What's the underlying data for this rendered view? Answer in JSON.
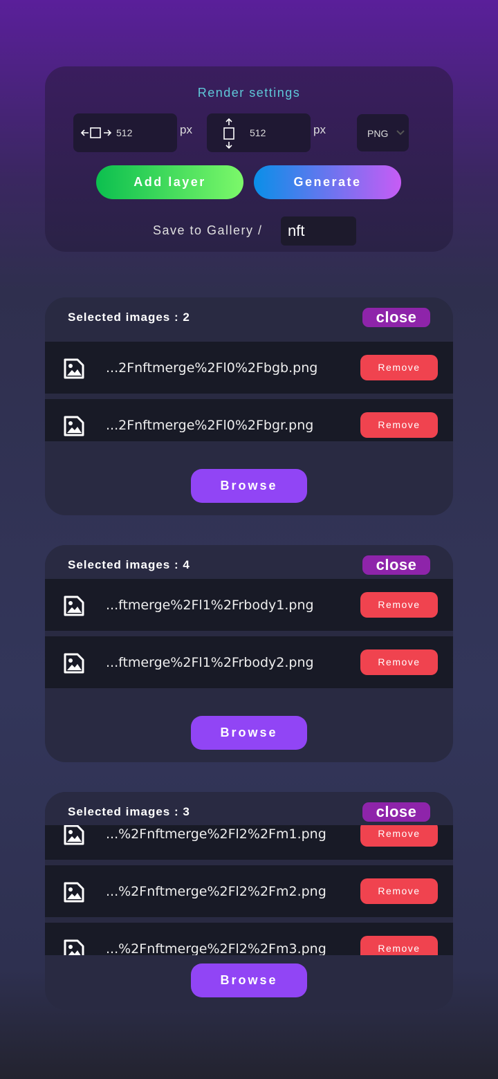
{
  "render": {
    "title": "Render settings",
    "width": "512",
    "height": "512",
    "unit": "px",
    "format": "PNG",
    "add_layer": "Add layer",
    "generate": "Generate",
    "save_label": "Save to Gallery /",
    "gallery": "nft"
  },
  "colors": {
    "add_layer": [
      "#0cbf4f",
      "#7cf86a"
    ],
    "generate": [
      "#0a8fe8",
      "#c75cf5"
    ],
    "remove": "#f0434f",
    "browse": "#9145f5",
    "close": "#8e24aa",
    "title": "#5fc8d8"
  },
  "layers": [
    {
      "count_label": "Selected images : 2",
      "close": "close",
      "browse": "Browse",
      "items": [
        {
          "name": "...2Fnftmerge%2Fl0%2Fbgb.png",
          "remove": "Remove"
        },
        {
          "name": "...2Fnftmerge%2Fl0%2Fbgr.png",
          "remove": "Remove"
        }
      ]
    },
    {
      "count_label": "Selected images : 4",
      "close": "close",
      "browse": "Browse",
      "items": [
        {
          "name": "",
          "remove": ""
        },
        {
          "name": "...ftmerge%2Fl1%2Frbody1.png",
          "remove": "Remove"
        },
        {
          "name": "...ftmerge%2Fl1%2Frbody2.png",
          "remove": "Remove"
        }
      ]
    },
    {
      "count_label": "Selected images : 3",
      "close": "close",
      "browse": "Browse",
      "items": [
        {
          "name": "...%2Fnftmerge%2Fl2%2Fm1.png",
          "remove": "Remove"
        },
        {
          "name": "...%2Fnftmerge%2Fl2%2Fm2.png",
          "remove": "Remove"
        },
        {
          "name": "...%2Fnftmerge%2Fl2%2Fm3.png",
          "remove": "Remove"
        }
      ]
    }
  ]
}
